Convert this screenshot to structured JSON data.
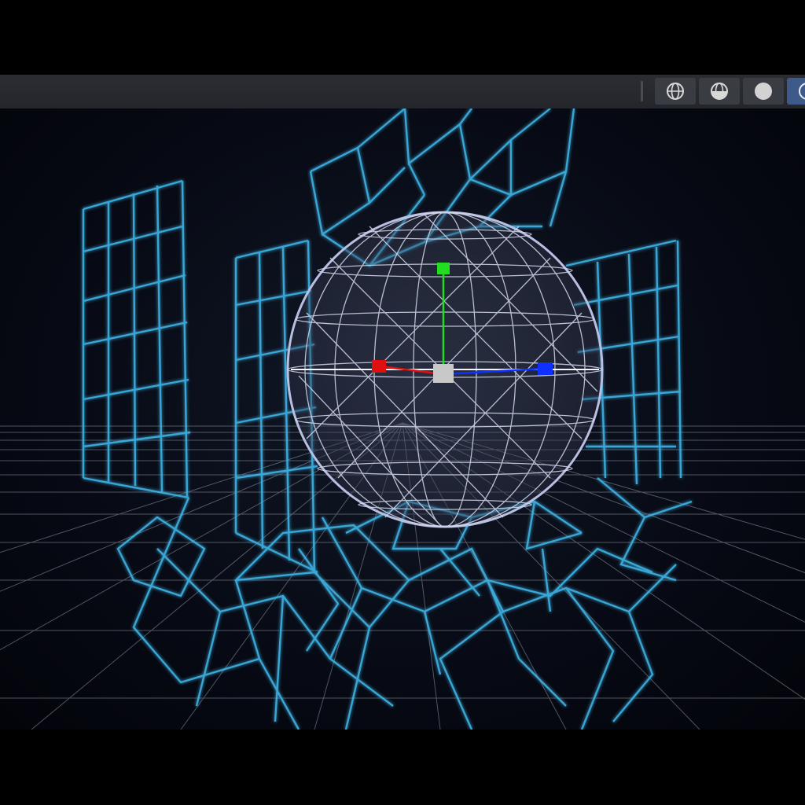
{
  "toolbar": {
    "shading_modes": [
      {
        "icon": "wireframe-sphere-icon",
        "active": false
      },
      {
        "icon": "solid-wireframe-sphere-icon",
        "active": false
      },
      {
        "icon": "solid-sphere-icon",
        "active": false
      },
      {
        "icon": "rendered-sphere-icon",
        "active": true
      }
    ]
  },
  "viewport": {
    "background": "#05070f",
    "grid_color": "#9aa0aa",
    "mesh_color": "#3fb7ea",
    "sphere_color": "#c8cde8",
    "gizmo": {
      "x_color": "#e01010",
      "y_color": "#22dd22",
      "z_color": "#1030ff",
      "center_color": "#c8c8c8"
    }
  }
}
